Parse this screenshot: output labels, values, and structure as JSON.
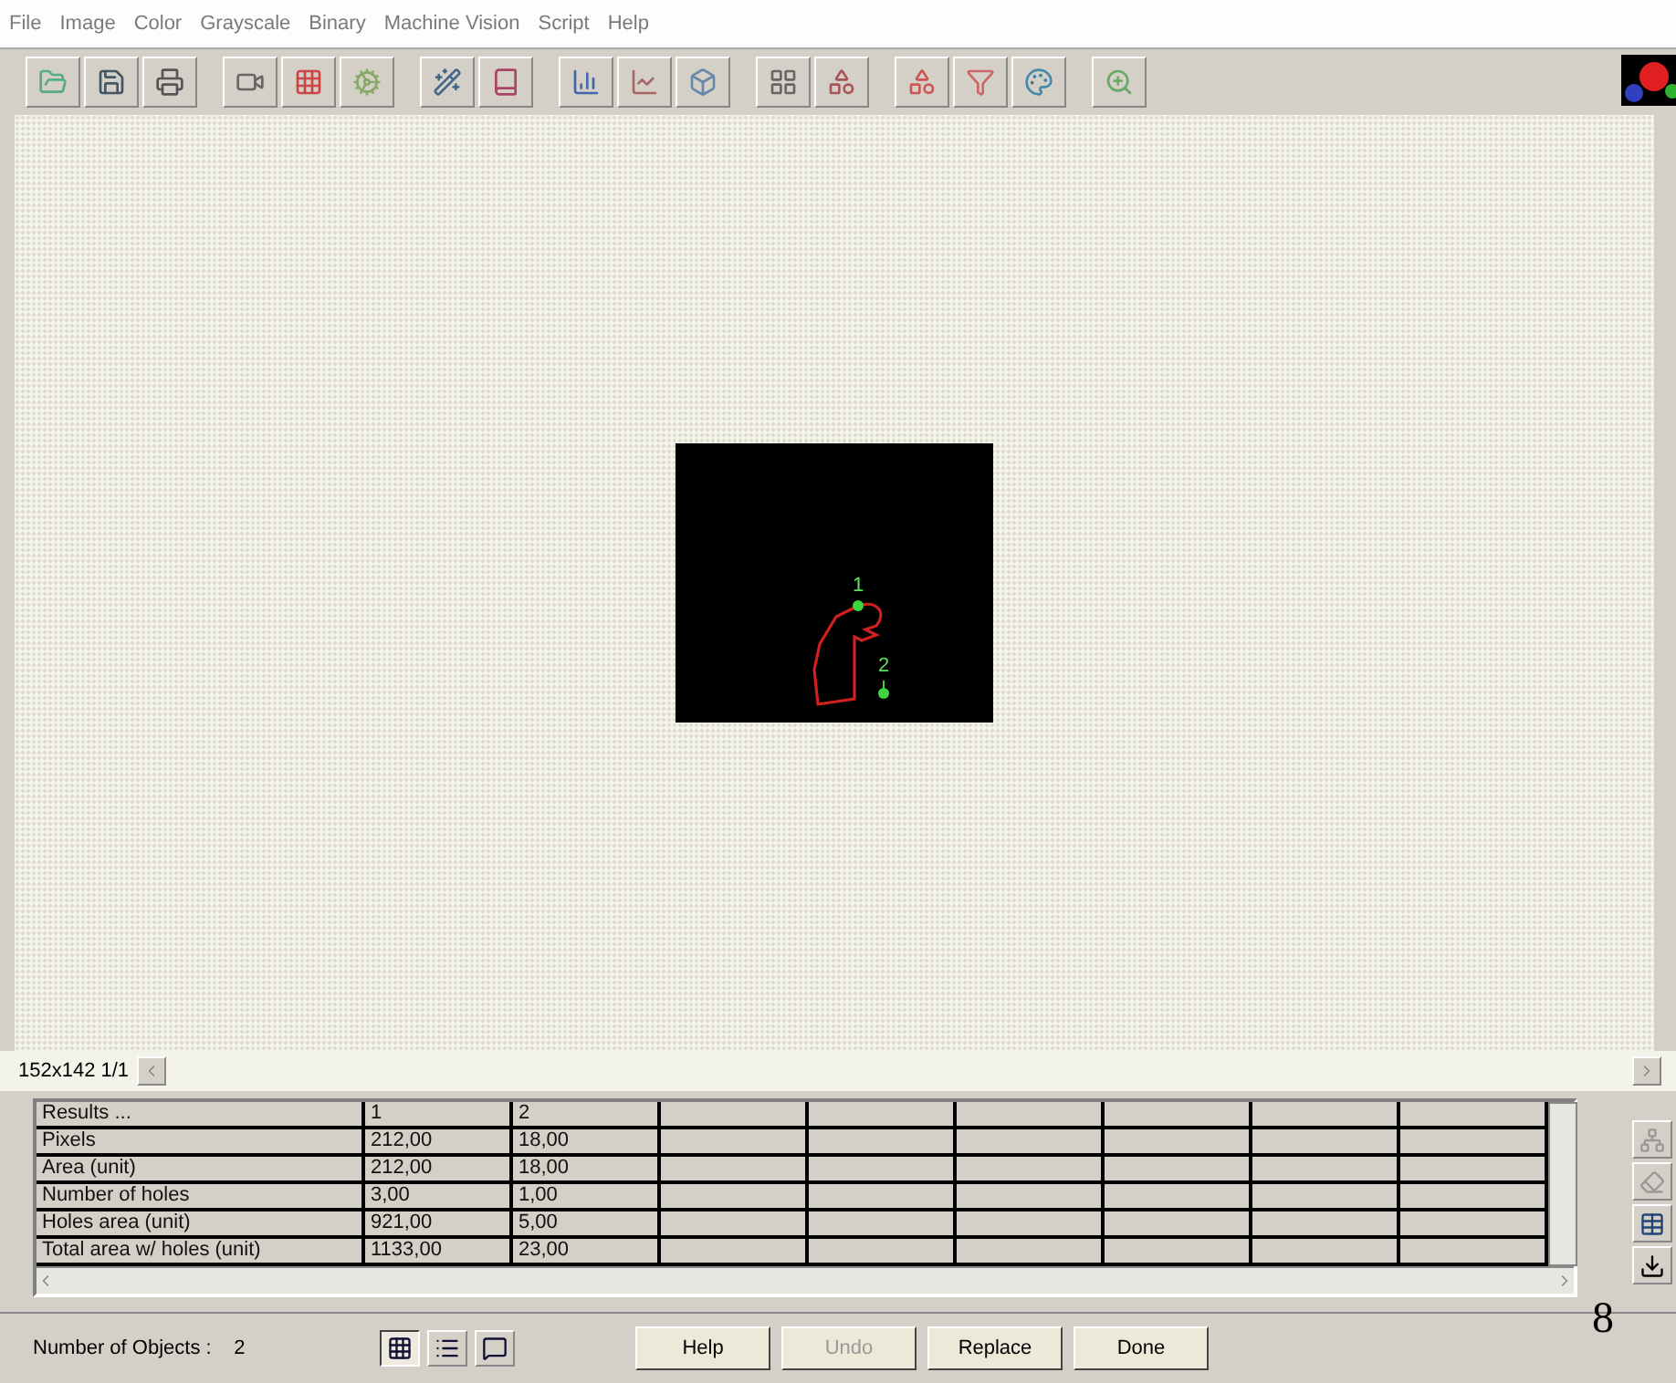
{
  "menu": [
    "File",
    "Image",
    "Color",
    "Grayscale",
    "Binary",
    "Machine Vision",
    "Script",
    "Help"
  ],
  "image_view": {
    "objects": [
      {
        "label": "1"
      },
      {
        "label": "2"
      }
    ]
  },
  "status": "152x142 1/1",
  "results_table": {
    "header": [
      "Results ...",
      "1",
      "2"
    ],
    "rows": [
      {
        "label": "Pixels",
        "values": [
          "212,00",
          "18,00"
        ]
      },
      {
        "label": "Area (unit)",
        "values": [
          "212,00",
          "18,00"
        ]
      },
      {
        "label": "Number of holes",
        "values": [
          "3,00",
          "1,00"
        ]
      },
      {
        "label": "Holes area (unit)",
        "values": [
          "921,00",
          "5,00"
        ]
      },
      {
        "label": "Total area w/ holes (unit)",
        "values": [
          "1133,00",
          "23,00"
        ]
      }
    ]
  },
  "object_count": {
    "label": "Number of Objects :",
    "value": "2"
  },
  "view_buttons": [
    {
      "kind": "grid",
      "selected": true
    },
    {
      "kind": "list",
      "selected": false
    },
    {
      "kind": "comment",
      "selected": false
    }
  ],
  "buttons": [
    {
      "label": "Help",
      "disabled": false
    },
    {
      "label": "Undo",
      "disabled": true
    },
    {
      "label": "Replace",
      "disabled": false
    },
    {
      "label": "Done",
      "disabled": false
    }
  ],
  "page_number": "8"
}
